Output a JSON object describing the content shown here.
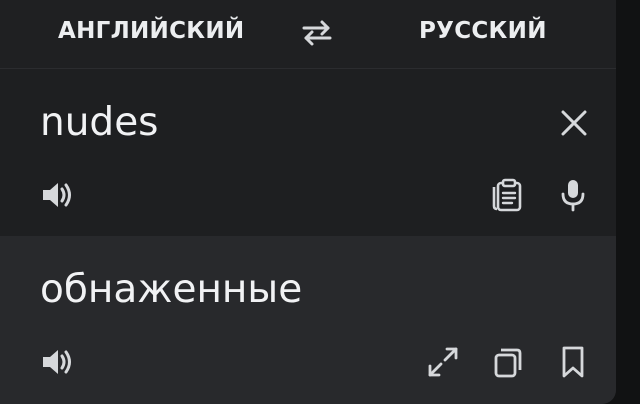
{
  "languages": {
    "source": "АНГЛИЙСКИЙ",
    "target": "РУССКИЙ"
  },
  "input": {
    "text": "nudes"
  },
  "output": {
    "text": "обнаженные"
  },
  "icons": {
    "swap": "swap-arrows-icon",
    "clear": "close-icon",
    "speaker": "speaker-icon",
    "paste": "clipboard-icon",
    "mic": "microphone-icon",
    "fullscreen": "expand-icon",
    "copy": "copy-icon",
    "bookmark": "bookmark-icon"
  },
  "colors": {
    "background": "#1e1f21",
    "output_background": "#28292c",
    "text": "#f1f2f4",
    "icon": "#d6d8db"
  }
}
